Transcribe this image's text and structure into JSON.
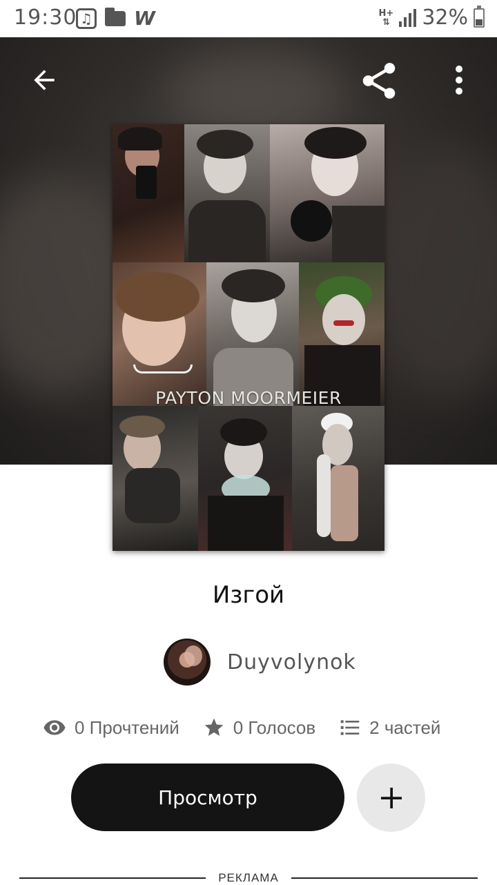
{
  "status_bar": {
    "time": "19:30",
    "network": "H+",
    "battery": "32%",
    "app_icon": "W"
  },
  "toolbar": {
    "back_icon": "arrow-left-icon",
    "share_icon": "share-icon",
    "more_icon": "more-vert-icon"
  },
  "story": {
    "cover_text": "PAYTON MOORMEIER",
    "title": "Изгой",
    "author": "Duyvolynok",
    "stats": {
      "reads": "0 Прочтений",
      "votes": "0 Голосов",
      "parts": "2 частей"
    }
  },
  "actions": {
    "read_label": "Просмотр",
    "add_icon": "plus-icon"
  },
  "ad": {
    "label": "РЕКЛАМА"
  },
  "colors": {
    "primary_button": "#141414",
    "secondary_button": "#e8e8e8",
    "hero_background": "#2e2b29"
  }
}
